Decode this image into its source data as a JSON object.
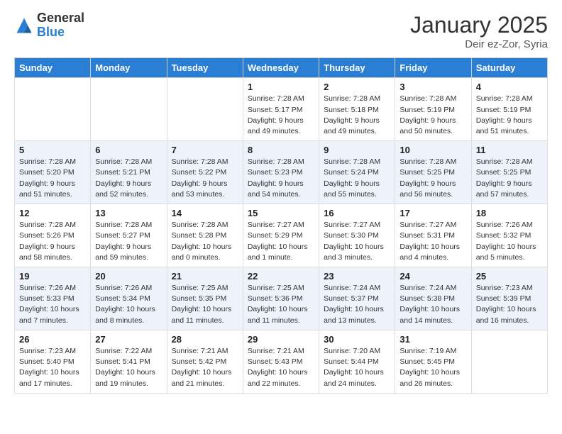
{
  "header": {
    "logo_general": "General",
    "logo_blue": "Blue",
    "title": "January 2025",
    "subtitle": "Deir ez-Zor, Syria"
  },
  "columns": [
    "Sunday",
    "Monday",
    "Tuesday",
    "Wednesday",
    "Thursday",
    "Friday",
    "Saturday"
  ],
  "weeks": [
    [
      {
        "day": "",
        "info": ""
      },
      {
        "day": "",
        "info": ""
      },
      {
        "day": "",
        "info": ""
      },
      {
        "day": "1",
        "info": "Sunrise: 7:28 AM\nSunset: 5:17 PM\nDaylight: 9 hours and 49 minutes."
      },
      {
        "day": "2",
        "info": "Sunrise: 7:28 AM\nSunset: 5:18 PM\nDaylight: 9 hours and 49 minutes."
      },
      {
        "day": "3",
        "info": "Sunrise: 7:28 AM\nSunset: 5:19 PM\nDaylight: 9 hours and 50 minutes."
      },
      {
        "day": "4",
        "info": "Sunrise: 7:28 AM\nSunset: 5:19 PM\nDaylight: 9 hours and 51 minutes."
      }
    ],
    [
      {
        "day": "5",
        "info": "Sunrise: 7:28 AM\nSunset: 5:20 PM\nDaylight: 9 hours and 51 minutes."
      },
      {
        "day": "6",
        "info": "Sunrise: 7:28 AM\nSunset: 5:21 PM\nDaylight: 9 hours and 52 minutes."
      },
      {
        "day": "7",
        "info": "Sunrise: 7:28 AM\nSunset: 5:22 PM\nDaylight: 9 hours and 53 minutes."
      },
      {
        "day": "8",
        "info": "Sunrise: 7:28 AM\nSunset: 5:23 PM\nDaylight: 9 hours and 54 minutes."
      },
      {
        "day": "9",
        "info": "Sunrise: 7:28 AM\nSunset: 5:24 PM\nDaylight: 9 hours and 55 minutes."
      },
      {
        "day": "10",
        "info": "Sunrise: 7:28 AM\nSunset: 5:25 PM\nDaylight: 9 hours and 56 minutes."
      },
      {
        "day": "11",
        "info": "Sunrise: 7:28 AM\nSunset: 5:25 PM\nDaylight: 9 hours and 57 minutes."
      }
    ],
    [
      {
        "day": "12",
        "info": "Sunrise: 7:28 AM\nSunset: 5:26 PM\nDaylight: 9 hours and 58 minutes."
      },
      {
        "day": "13",
        "info": "Sunrise: 7:28 AM\nSunset: 5:27 PM\nDaylight: 9 hours and 59 minutes."
      },
      {
        "day": "14",
        "info": "Sunrise: 7:28 AM\nSunset: 5:28 PM\nDaylight: 10 hours and 0 minutes."
      },
      {
        "day": "15",
        "info": "Sunrise: 7:27 AM\nSunset: 5:29 PM\nDaylight: 10 hours and 1 minute."
      },
      {
        "day": "16",
        "info": "Sunrise: 7:27 AM\nSunset: 5:30 PM\nDaylight: 10 hours and 3 minutes."
      },
      {
        "day": "17",
        "info": "Sunrise: 7:27 AM\nSunset: 5:31 PM\nDaylight: 10 hours and 4 minutes."
      },
      {
        "day": "18",
        "info": "Sunrise: 7:26 AM\nSunset: 5:32 PM\nDaylight: 10 hours and 5 minutes."
      }
    ],
    [
      {
        "day": "19",
        "info": "Sunrise: 7:26 AM\nSunset: 5:33 PM\nDaylight: 10 hours and 7 minutes."
      },
      {
        "day": "20",
        "info": "Sunrise: 7:26 AM\nSunset: 5:34 PM\nDaylight: 10 hours and 8 minutes."
      },
      {
        "day": "21",
        "info": "Sunrise: 7:25 AM\nSunset: 5:35 PM\nDaylight: 10 hours and 11 minutes."
      },
      {
        "day": "22",
        "info": "Sunrise: 7:25 AM\nSunset: 5:36 PM\nDaylight: 10 hours and 11 minutes."
      },
      {
        "day": "23",
        "info": "Sunrise: 7:24 AM\nSunset: 5:37 PM\nDaylight: 10 hours and 13 minutes."
      },
      {
        "day": "24",
        "info": "Sunrise: 7:24 AM\nSunset: 5:38 PM\nDaylight: 10 hours and 14 minutes."
      },
      {
        "day": "25",
        "info": "Sunrise: 7:23 AM\nSunset: 5:39 PM\nDaylight: 10 hours and 16 minutes."
      }
    ],
    [
      {
        "day": "26",
        "info": "Sunrise: 7:23 AM\nSunset: 5:40 PM\nDaylight: 10 hours and 17 minutes."
      },
      {
        "day": "27",
        "info": "Sunrise: 7:22 AM\nSunset: 5:41 PM\nDaylight: 10 hours and 19 minutes."
      },
      {
        "day": "28",
        "info": "Sunrise: 7:21 AM\nSunset: 5:42 PM\nDaylight: 10 hours and 21 minutes."
      },
      {
        "day": "29",
        "info": "Sunrise: 7:21 AM\nSunset: 5:43 PM\nDaylight: 10 hours and 22 minutes."
      },
      {
        "day": "30",
        "info": "Sunrise: 7:20 AM\nSunset: 5:44 PM\nDaylight: 10 hours and 24 minutes."
      },
      {
        "day": "31",
        "info": "Sunrise: 7:19 AM\nSunset: 5:45 PM\nDaylight: 10 hours and 26 minutes."
      },
      {
        "day": "",
        "info": ""
      }
    ]
  ]
}
